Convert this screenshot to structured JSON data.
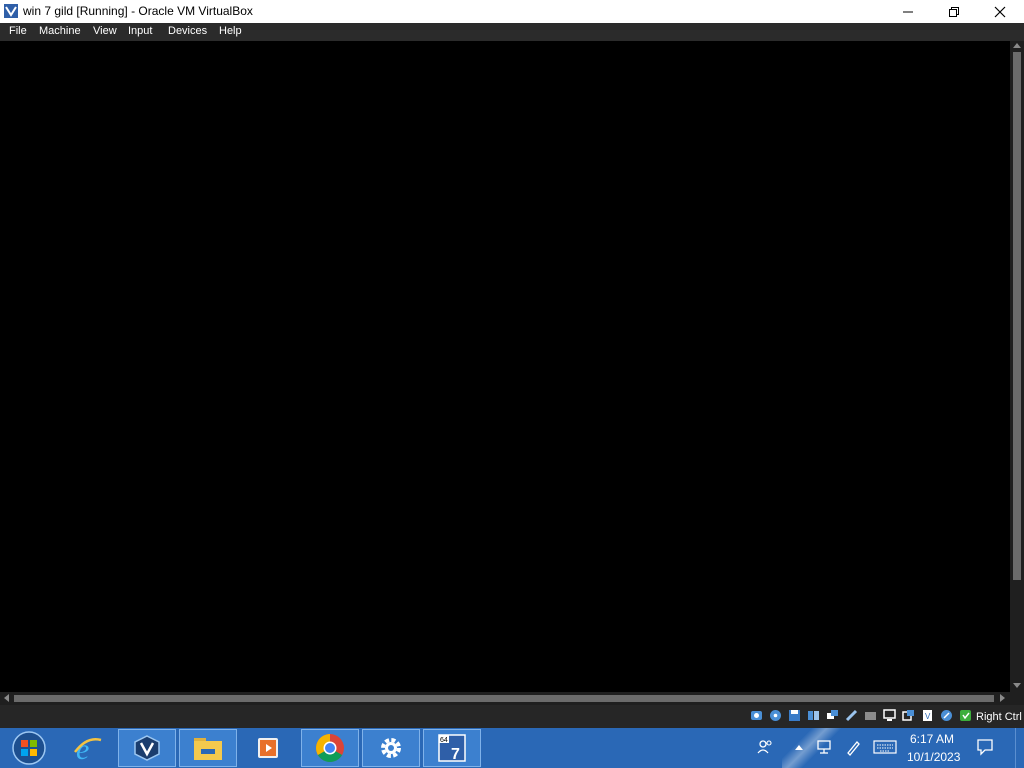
{
  "window": {
    "title": "win 7 gild [Running] - Oracle VM VirtualBox",
    "icon": "virtualbox-icon",
    "controls": {
      "minimize": "minimize-icon",
      "maximize": "restore-icon",
      "close": "close-icon"
    }
  },
  "menubar": {
    "items": [
      {
        "label": "File"
      },
      {
        "label": "Machine"
      },
      {
        "label": "View"
      },
      {
        "label": "Input"
      },
      {
        "label": "Devices"
      },
      {
        "label": "Help"
      }
    ]
  },
  "statusbar": {
    "icons": [
      "hard-disk-icon",
      "optical-drive-icon",
      "floppy-icon",
      "audio-icon",
      "network-icon",
      "usb-icon",
      "shared-folder-icon",
      "display-icon",
      "video-capture-icon",
      "cpu-icon",
      "mouse-integration-icon",
      "keyboard-capture-icon"
    ],
    "host_key": "Right Ctrl"
  },
  "taskbar": {
    "apps": [
      "start-orb-icon",
      "internet-explorer-icon",
      "virtualbox-icon",
      "file-explorer-icon",
      "media-player-icon",
      "chrome-icon",
      "settings-gear-icon",
      "win7-vm-icon"
    ],
    "active_apps": [
      "virtualbox-icon",
      "file-explorer-icon",
      "chrome-icon",
      "settings-gear-icon",
      "win7-vm-icon"
    ],
    "tray": {
      "icons": [
        "people-icon",
        "chevron-up-icon",
        "network-icon",
        "pen-icon",
        "keyboard-icon",
        "notification-icon"
      ],
      "time": "6:17 AM",
      "date": "10/1/2023"
    }
  },
  "colors": {
    "titlebar": "#ffffff",
    "menubar": "#2b2b2b",
    "vm_screen": "#000000",
    "statusbar": "#262626",
    "taskbar": "#2a68b6",
    "taskbar_active": "#3c80cf"
  }
}
